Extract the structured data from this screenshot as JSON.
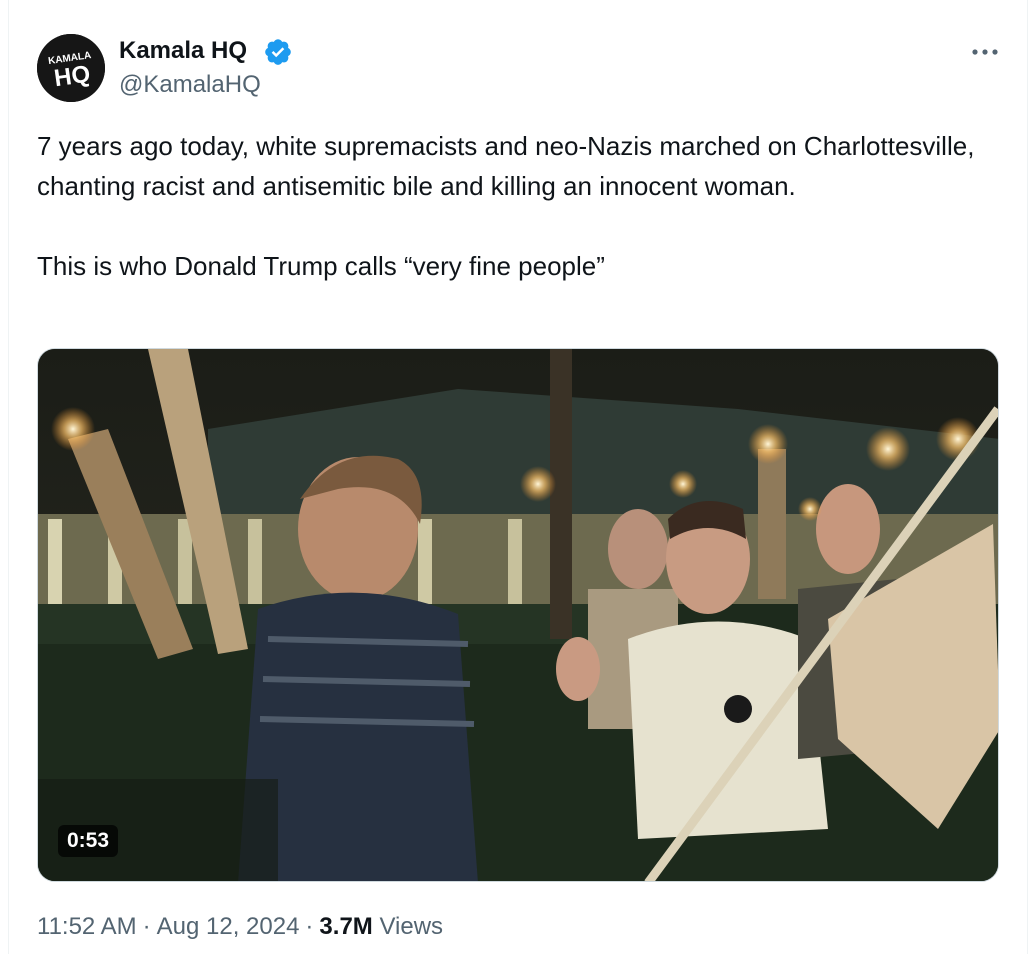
{
  "author": {
    "name": "Kamala HQ",
    "handle": "@KamalaHQ",
    "avatar_text_top": "KAMALA",
    "avatar_text_main": "HQ",
    "verified_color": "#1d9bf0"
  },
  "menu": {
    "icon": "more-horizontal-icon"
  },
  "tweet": {
    "paragraph_1": "7 years ago today, white supremacists and neo-Nazis marched on Charlottesville, chanting racist and antisemitic bile and killing an innocent woman.",
    "paragraph_2": "This is who Donald Trump calls “very fine people”"
  },
  "media": {
    "type": "video",
    "duration": "0:53"
  },
  "meta": {
    "time": "11:52 AM",
    "separator": "·",
    "date": "Aug 12, 2024",
    "views_count": "3.7M",
    "views_label": "Views"
  },
  "colors": {
    "text_primary": "#0f1419",
    "text_secondary": "#536471",
    "accent": "#1d9bf0"
  }
}
